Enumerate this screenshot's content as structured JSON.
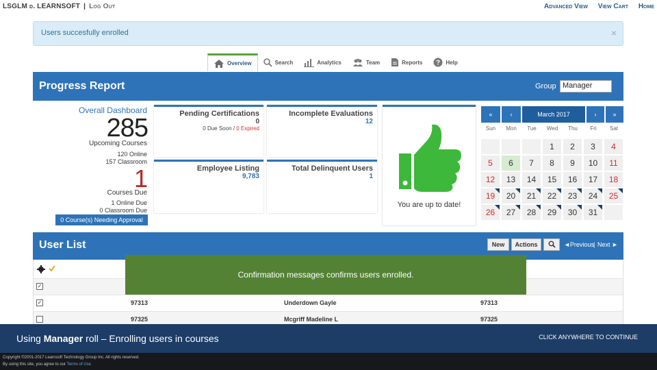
{
  "topbar": {
    "user": "LSGLM d. LEARNSOFT",
    "sep": "|",
    "logout": "Log Out",
    "advanced_view": "Advanced View",
    "view_cart": "View Cart",
    "home": "Home"
  },
  "alert": {
    "message": "Users succesfully enrolled",
    "close": "×"
  },
  "tabs": [
    {
      "label": "Overview",
      "icon": "home-icon",
      "active": true
    },
    {
      "label": "Search",
      "icon": "search-icon"
    },
    {
      "label": "Analytics",
      "icon": "analytics-icon"
    },
    {
      "label": "Team",
      "icon": "team-icon"
    },
    {
      "label": "Reports",
      "icon": "reports-icon"
    },
    {
      "label": "Help",
      "icon": "help-icon"
    }
  ],
  "progress": {
    "title": "Progress Report",
    "group_label": "Group",
    "group_value": "Manager"
  },
  "dashboard": {
    "title": "Overall Dashboard",
    "upcoming_count": "285",
    "upcoming_label": "Upcoming Courses",
    "online": "120 Online",
    "classroom": "157 Classroom",
    "due_count": "1",
    "due_label": "Courses Due",
    "due_online": "1 Online Due",
    "due_classroom": "0 Classroom Due",
    "approval": "0 Course(s) Needing Approval"
  },
  "cards": {
    "pending": {
      "title": "Pending Certifications",
      "value": "0",
      "due_soon": "0 Due Soon",
      "slash": " / ",
      "expired": "0 Expired"
    },
    "incomplete": {
      "title": "Incomplete Evaluations",
      "value": "12"
    },
    "employee": {
      "title": "Employee Listing",
      "value": "9,783"
    },
    "delinquent": {
      "title": "Total Delinquent Users",
      "value": "1"
    }
  },
  "status": {
    "message": "You are up to date!",
    "icon": "thumbs-up-icon",
    "color": "#3db83a"
  },
  "calendar": {
    "prev_year": "«",
    "prev_month": "‹",
    "month": "March 2017",
    "next_month": "›",
    "next_year": "»",
    "days_of_week": [
      "Sun",
      "Mon",
      "Tue",
      "Wed",
      "Thu",
      "Fri",
      "Sat"
    ],
    "weeks": [
      [
        "",
        "",
        "",
        "1",
        "2",
        "3",
        "4"
      ],
      [
        "5",
        "6",
        "7",
        "8",
        "9",
        "10",
        "11"
      ],
      [
        "12",
        "13",
        "14",
        "15",
        "16",
        "17",
        "18"
      ],
      [
        "19",
        "20",
        "21",
        "22",
        "23",
        "24",
        "25"
      ],
      [
        "26",
        "27",
        "28",
        "29",
        "30",
        "31",
        ""
      ]
    ],
    "today": "6"
  },
  "userlist": {
    "title": "User List",
    "new_btn": "New",
    "actions_btn": "Actions",
    "previous": "◄Previous",
    "sep": "|",
    "next": "Next ►",
    "rows": [
      {
        "id": "97313",
        "name": "Underdown Gayle",
        "id2": "97313"
      },
      {
        "id": "97325",
        "name": "Mcgriff Madeline L",
        "id2": "97325"
      }
    ]
  },
  "tooltip": "Confirmation messages confirms users enrolled.",
  "banner": {
    "title_pre": "Using ",
    "title_bold": "Manager",
    "title_post": " roll – Enrolling users in courses",
    "cta": "CLICK ANYWHERE TO CONTINUE"
  },
  "footer": {
    "copyright": "Copyright ©2001-2017 Learnsoft Technology Group Inc. All rights reserved.",
    "agree": "By using this site, you agree to our ",
    "terms": "Terms of Use"
  },
  "colors": {
    "brand_blue": "#2e73b8",
    "tooltip_green": "#548235",
    "banner_navy": "#1d3c66"
  }
}
